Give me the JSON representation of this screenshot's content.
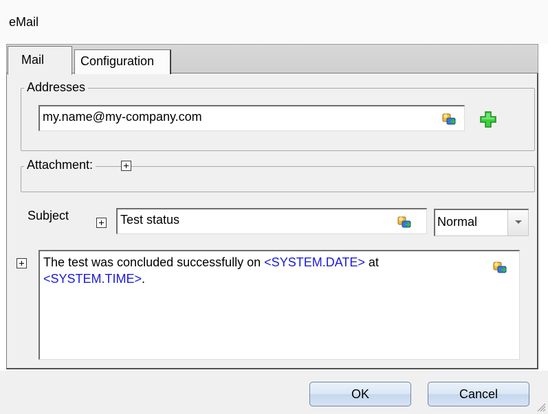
{
  "window": {
    "title": "eMail"
  },
  "tabs": [
    {
      "label": "Mail"
    },
    {
      "label": "Configuration"
    }
  ],
  "addresses": {
    "legend": "Addresses",
    "value": "my.name@my-company.com",
    "add_icon": "green-plus-icon"
  },
  "attachment": {
    "legend": "Attachment:"
  },
  "subject": {
    "label": "Subject",
    "value": "Test status",
    "priority": "Normal"
  },
  "body": {
    "text_before": "The test was concluded successfully on ",
    "var_date": "<SYSTEM.DATE>",
    "text_mid": " at",
    "var_time": "<SYSTEM.TIME>",
    "text_after": "."
  },
  "buttons": {
    "ok": "OK",
    "cancel": "Cancel"
  },
  "colors": {
    "variable": "#1a1adb",
    "button_border": "#6f87a8",
    "add_icon": "#2fbf2f"
  }
}
